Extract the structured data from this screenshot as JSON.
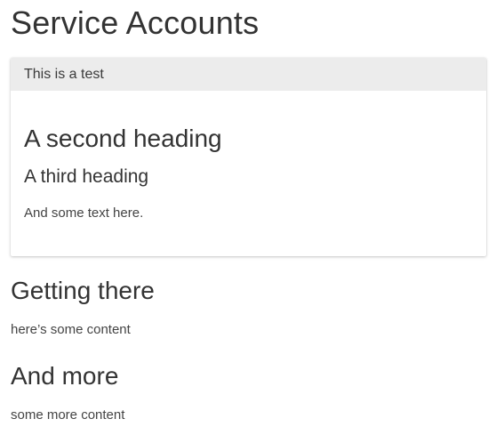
{
  "page": {
    "title": "Service Accounts"
  },
  "panel": {
    "header": "This is a test",
    "heading_2": "A second heading",
    "heading_3": "A third heading",
    "text": "And some text here."
  },
  "sections": [
    {
      "heading": "Getting there",
      "text": "here’s some content"
    },
    {
      "heading": "And more",
      "text": "some more content"
    }
  ]
}
